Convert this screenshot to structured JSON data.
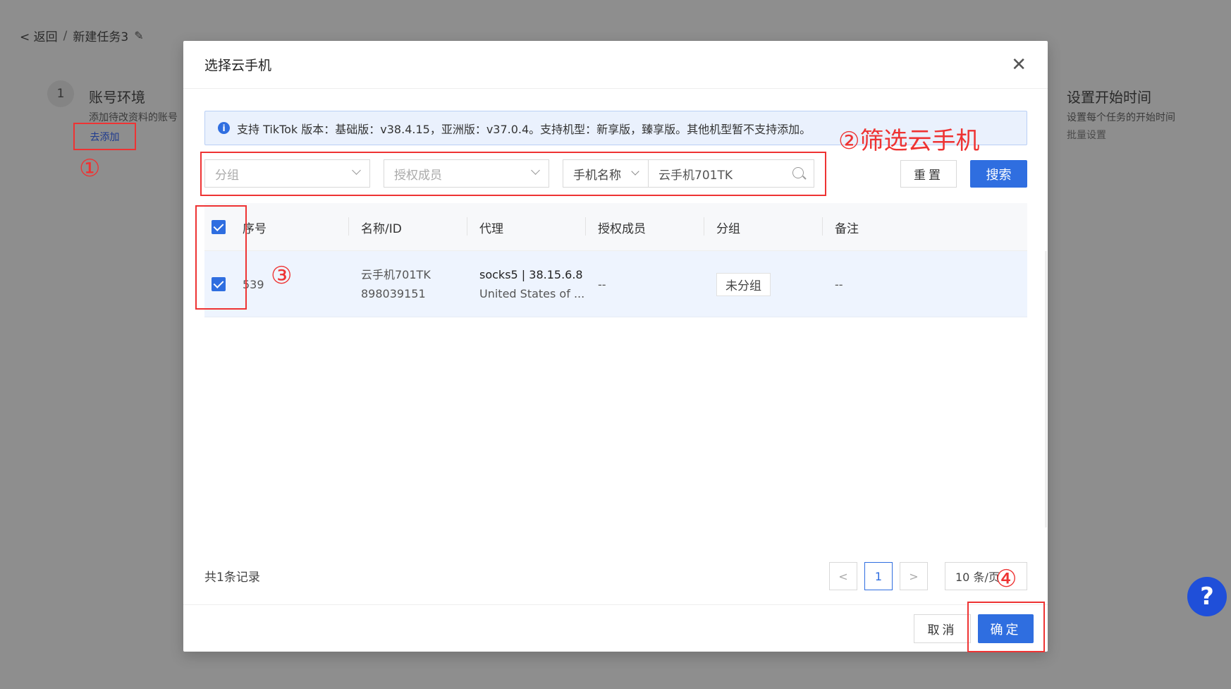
{
  "background": {
    "breadcrumb": {
      "back": "< 返回",
      "separator": "/",
      "task_name": "新建任务3"
    },
    "step": {
      "number": "1",
      "title": "账号环境",
      "desc": "添加待改资料的账号",
      "add_link": "去添加"
    },
    "right_step": {
      "title": "设置开始时间",
      "desc": "设置每个任务的开始时间",
      "sub": "批量设置"
    }
  },
  "annotations": {
    "mark1": "①",
    "mark2": "②筛选云手机",
    "mark3": "③",
    "mark4": "④"
  },
  "modal": {
    "title": "选择云手机",
    "info": "支持 TikTok 版本：基础版：v38.4.15，亚洲版：v37.0.4。支持机型：新享版，臻享版。其他机型暂不支持添加。",
    "filters": {
      "group_placeholder": "分组",
      "member_placeholder": "授权成员",
      "name_type": "手机名称",
      "search_value": "云手机701TK"
    },
    "buttons": {
      "reset": "重置",
      "search": "搜索",
      "cancel": "取消",
      "confirm": "确定"
    },
    "table": {
      "columns": [
        "序号",
        "名称/ID",
        "代理",
        "授权成员",
        "分组",
        "备注"
      ],
      "rows": [
        {
          "index": "539",
          "name": "云手机701TK",
          "id": "898039151",
          "proxy_line1": "socks5 | 38.15.6.8",
          "proxy_line2": "United States of ...",
          "member": "--",
          "group": "未分组",
          "note": "--"
        }
      ]
    },
    "pagination": {
      "total": "共1条记录",
      "prev": "<",
      "page": "1",
      "next": ">",
      "page_size": "10 条/页"
    }
  },
  "help": {
    "label": "?"
  },
  "colors": {
    "primary": "#2f6ee0",
    "annotation": "#ee3333",
    "row_highlight": "#eef4fe"
  }
}
